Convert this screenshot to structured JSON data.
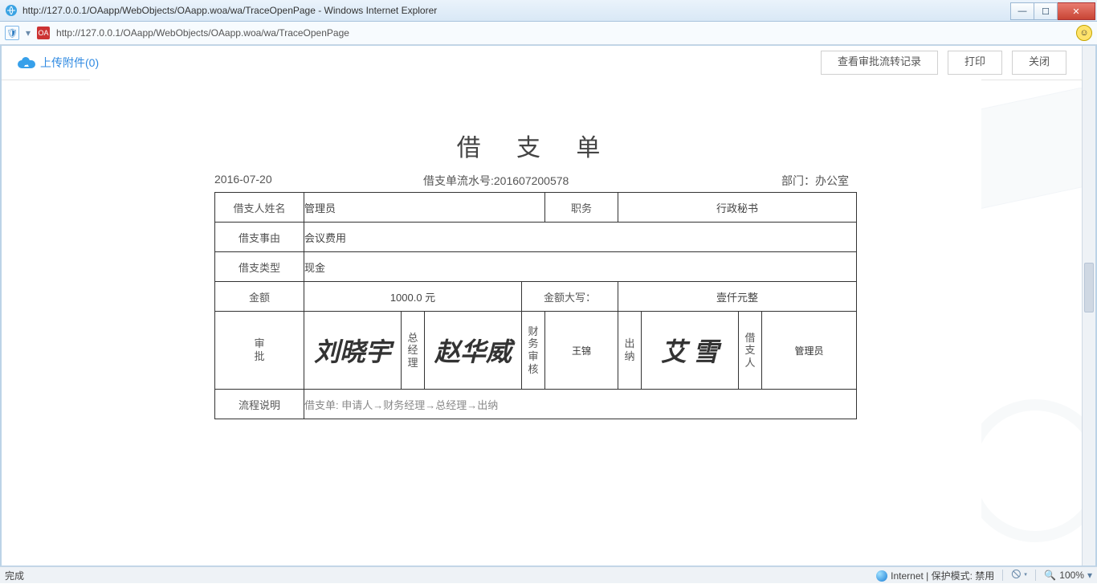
{
  "browser": {
    "window_title": "http://127.0.0.1/OAapp/WebObjects/OAapp.woa/wa/TraceOpenPage - Windows Internet Explorer",
    "url": "http://127.0.0.1/OAapp/WebObjects/OAapp.woa/wa/TraceOpenPage",
    "favicon_text": "OA"
  },
  "topbar": {
    "upload_label": "上传附件(0)",
    "btn_history": "查看审批流转记录",
    "btn_print": "打印",
    "btn_close": "关闭"
  },
  "form": {
    "title": "借 支 单",
    "date": "2016-07-20",
    "serial_label": "借支单流水号:201607200578",
    "dept_label": "部门：办公室",
    "rows": {
      "name_label": "借支人姓名",
      "name_value": "管理员",
      "pos_label": "职务",
      "pos_value": "行政秘书",
      "reason_label": "借支事由",
      "reason_value": "会议费用",
      "type_label": "借支类型",
      "type_value": "现金",
      "amount_label": "金额",
      "amount_value": "1000.0 元",
      "amount_cn_label": "金额大写：",
      "amount_cn_value": "壹仟元整"
    },
    "signatures": {
      "approve_label_1": "审",
      "approve_label_2": "批",
      "sig1": "刘晓宇",
      "role1_1": "总",
      "role1_2": "经",
      "role1_3": "理",
      "sig2": "赵华威",
      "role2_1": "财",
      "role2_2": "务",
      "role2_3": "审",
      "role2_4": "核",
      "sig3": "王锦",
      "role3_1": "出",
      "role3_2": "纳",
      "sig4": "艾 雪",
      "role4_1": "借",
      "role4_2": "支",
      "role4_3": "人",
      "sig5": "管理员"
    },
    "flow": {
      "label": "流程说明",
      "value": "借支单: 申请人→财务经理→总经理→出纳"
    }
  },
  "statusbar": {
    "left": "完成",
    "zone": "Internet | 保护模式: 禁用",
    "zoom": "100%"
  }
}
